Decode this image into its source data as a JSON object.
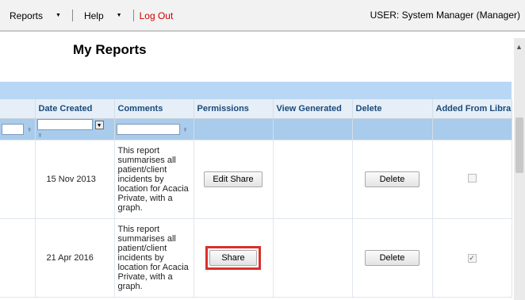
{
  "topbar": {
    "reports_label": "Reports",
    "help_label": "Help",
    "logout_label": "Log Out",
    "user_text": "USER: System Manager (Manager)"
  },
  "page": {
    "title": "My Reports"
  },
  "table": {
    "headers": [
      "Date Created",
      "Comments",
      "Permissions",
      "View Generated",
      "Delete",
      "Added From Library"
    ],
    "rows": [
      {
        "date": "15 Nov 2013",
        "comment": "This report summarises all patient/client incidents by location for Acacia Private, with a graph.",
        "permission_label": "Edit Share",
        "delete_label": "Delete",
        "added_from_library": false
      },
      {
        "date": "21 Apr 2016",
        "comment": "This report summarises all patient/client incidents by location for Acacia Private, with a graph.",
        "permission_label": "Share",
        "delete_label": "Delete",
        "added_from_library": true
      }
    ]
  },
  "colors": {
    "band": "#b8d7f4",
    "header_text": "#1a4a7a",
    "highlight": "#d9302a",
    "logout": "#cc0000"
  }
}
